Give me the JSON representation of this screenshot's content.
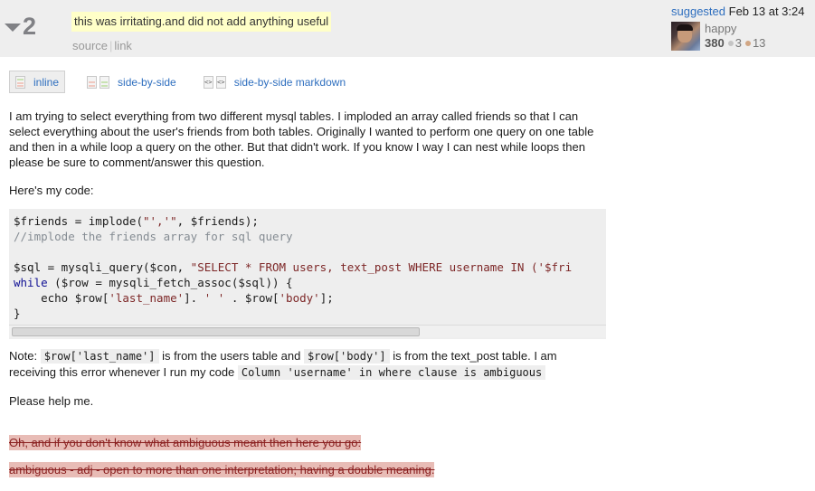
{
  "header": {
    "vote_count": "2",
    "comment": "this was irritating.and did not add anything useful",
    "links": [
      "source",
      "link"
    ],
    "user": {
      "action": "suggested",
      "date": "Feb 13 at 3:24",
      "name": "happy",
      "reputation": "380",
      "silver_badges": "3",
      "bronze_badges": "13"
    }
  },
  "tabs": [
    {
      "label": "inline",
      "icon": "inline-diff-icon",
      "active": true
    },
    {
      "label": "side-by-side",
      "icon": "side-by-side-diff-icon",
      "active": false
    },
    {
      "label": "side-by-side markdown",
      "icon": "side-by-side-markdown-icon",
      "active": false
    }
  ],
  "post": {
    "para1": "I am trying to select everything from two different mysql tables. I imploded an array called friends so that I can select everything about the user's friends from both tables. Originally I wanted to perform one query on one table and then in a while loop a query on the other. But that didn't work. If you know I way I can nest while loops then please be sure to comment/answer this question.",
    "para2": "Here's my code:",
    "code": {
      "line1_a": "$friends = implode(",
      "line1_str": "\"','\"",
      "line1_b": ", $friends);",
      "line2": "//implode the friends array for sql query",
      "line4_a": "$sql = mysqli_query($con, ",
      "line4_str": "\"SELECT * FROM users, text_post WHERE username IN ('$fri",
      "line5_kw": "while",
      "line5_b": " ($row = mysqli_fetch_assoc($sql)) {",
      "line6_a": "    echo $row[",
      "line6_s1": "'last_name'",
      "line6_b": "]. ",
      "line6_s2": "' '",
      "line6_c": " . $row[",
      "line6_s3": "'body'",
      "line6_d": "];",
      "line7": "}",
      "scroll_fraction": 0.69
    },
    "note_prefix": "Note: ",
    "note_code1": "$row['last_name']",
    "note_mid": " is from the users table and ",
    "note_code2": "$row['body']",
    "note_suffix": " is from the text_post table. I am receiving this error whenever I run my code ",
    "note_error": "Column 'username' in where clause is ambiguous",
    "help": "Please help me.",
    "deleted1": "Oh, and if you don't know what ambiguous meant then here you go:",
    "deleted2": "ambiguous - adj - open to more than one interpretation; having a double meaning."
  }
}
